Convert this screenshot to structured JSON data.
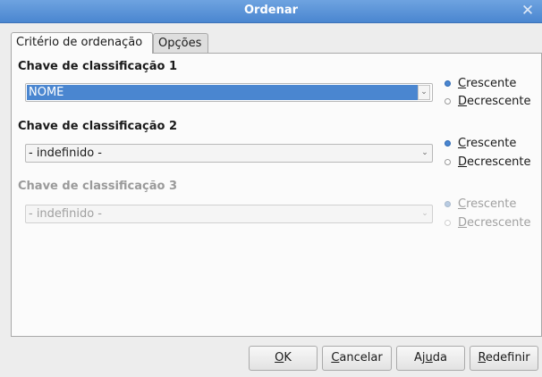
{
  "window": {
    "title": "Ordenar"
  },
  "tabs": [
    {
      "label": "Critério de ordenação",
      "active": true
    },
    {
      "label": "Opções",
      "active": false
    }
  ],
  "keys": [
    {
      "label": "Chave de classificação 1",
      "value": "NOME",
      "selected": true,
      "enabled": true,
      "ascending": {
        "label_first": "C",
        "label_rest": "rescente",
        "checked": true
      },
      "descending": {
        "label_first": "D",
        "label_rest": "ecrescente",
        "checked": false
      }
    },
    {
      "label": "Chave de classificação 2",
      "value": "- indefinido -",
      "selected": false,
      "enabled": true,
      "ascending": {
        "label_first": "C",
        "label_rest": "rescente",
        "checked": true
      },
      "descending": {
        "label_first": "D",
        "label_rest": "ecrescente",
        "checked": false
      }
    },
    {
      "label": "Chave de classificação 3",
      "value": "- indefinido -",
      "selected": false,
      "enabled": false,
      "ascending": {
        "label_first": "C",
        "label_rest": "rescente",
        "checked": true
      },
      "descending": {
        "label_first": "D",
        "label_rest": "ecrescente",
        "checked": false
      }
    }
  ],
  "buttons": {
    "ok": {
      "pre": "",
      "key": "O",
      "post": "K"
    },
    "cancel": {
      "pre": "",
      "key": "C",
      "post": "ancelar"
    },
    "help": {
      "pre": "Aj",
      "key": "u",
      "post": "da"
    },
    "reset": {
      "pre": "",
      "key": "R",
      "post": "edefinir"
    }
  },
  "colors": {
    "accent": "#4a86d0",
    "titlebar": "#5a93d8"
  }
}
